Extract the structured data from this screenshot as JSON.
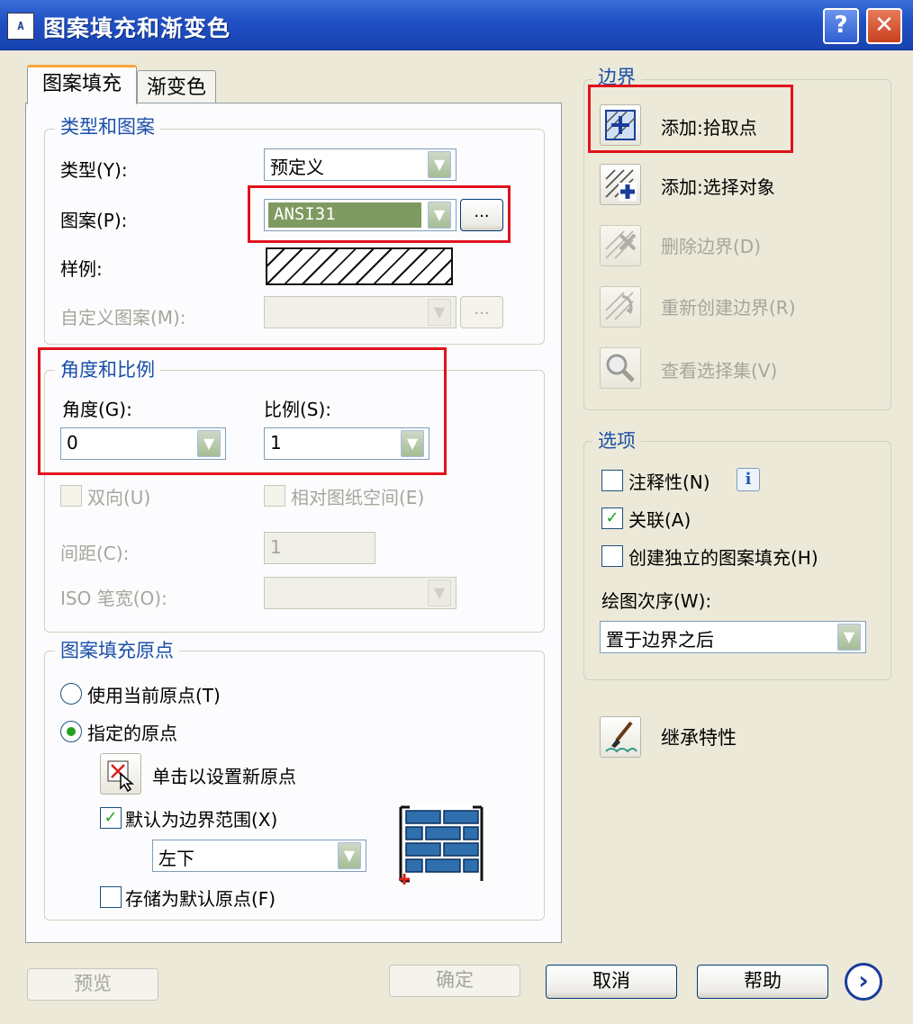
{
  "window": {
    "title": "图案填充和渐变色",
    "app_icon": "A",
    "help_glyph": "?",
    "close_glyph": "✕"
  },
  "tabs": [
    {
      "label": "图案填充",
      "active": true
    },
    {
      "label": "渐变色",
      "active": false
    }
  ],
  "type_pattern": {
    "group_label": "类型和图案",
    "type_label": "类型(Y):",
    "type_value": "预定义",
    "pattern_label": "图案(P):",
    "pattern_value": "ANSI31",
    "browse_label": "...",
    "swatch_label": "样例:",
    "custom_label": "自定义图案(M):",
    "custom_browse_label": "..."
  },
  "angle_scale": {
    "group_label": "角度和比例",
    "angle_label": "角度(G):",
    "angle_value": "0",
    "scale_label": "比例(S):",
    "scale_value": "1",
    "double_label": "双向(U)",
    "relative_label": "相对图纸空间(E)",
    "spacing_label": "间距(C):",
    "spacing_value": "1",
    "iso_label": "ISO 笔宽(O):"
  },
  "origin": {
    "group_label": "图案填充原点",
    "use_current_label": "使用当前原点(T)",
    "specified_label": "指定的原点",
    "click_set_label": "单击以设置新原点",
    "default_extent_label": "默认为边界范围(X)",
    "default_extent_checked": true,
    "position_value": "左下",
    "store_default_label": "存储为默认原点(F)",
    "store_default_checked": false
  },
  "boundaries": {
    "group_label": "边界",
    "items": [
      {
        "label": "添加:拾取点",
        "icon": "pick-point-icon",
        "enabled": true
      },
      {
        "label": "添加:选择对象",
        "icon": "select-objects-icon",
        "enabled": true
      },
      {
        "label": "删除边界(D)",
        "icon": "remove-boundary-icon",
        "enabled": false
      },
      {
        "label": "重新创建边界(R)",
        "icon": "recreate-boundary-icon",
        "enabled": false
      },
      {
        "label": "查看选择集(V)",
        "icon": "magnifier-icon",
        "enabled": false
      }
    ]
  },
  "options": {
    "group_label": "选项",
    "annotative_label": "注释性(N)",
    "annotative_checked": false,
    "info_glyph": "i",
    "associative_label": "关联(A)",
    "associative_checked": true,
    "separate_label": "创建独立的图案填充(H)",
    "separate_checked": false,
    "draw_order_label": "绘图次序(W):",
    "draw_order_value": "置于边界之后"
  },
  "inherit_label": "继承特性",
  "footer": {
    "preview": "预览",
    "ok": "确定",
    "cancel": "取消",
    "help": "帮助",
    "more_glyph": "›"
  },
  "colors": {
    "highlight_red": "#e0121c",
    "pattern_field": "#7f9a61",
    "brick_blue": "#2f6fae"
  }
}
